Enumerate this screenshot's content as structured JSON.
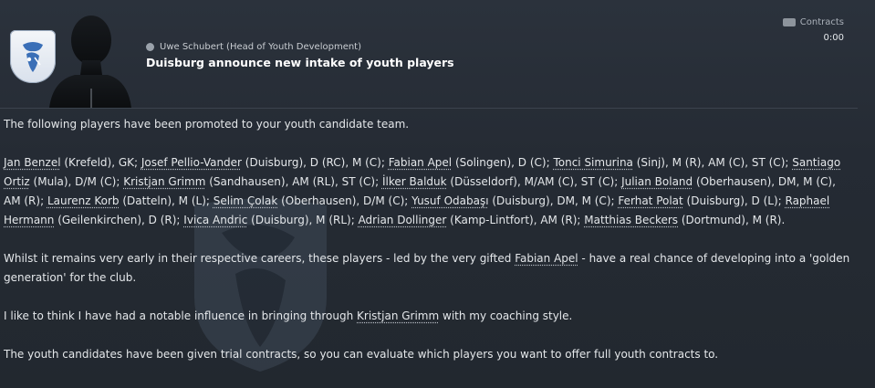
{
  "message": {
    "author": "Uwe Schubert  (Head of Youth Development)",
    "headline": "Duisburg announce new intake of youth players",
    "category": "Contracts",
    "time": "0:00"
  },
  "body": {
    "intro": "The following players have been promoted to your youth candidate team.",
    "players": [
      {
        "name": "Jan Benzel",
        "detail": " (Krefeld), GK; "
      },
      {
        "name": "Josef Pellio-Vander",
        "detail": " (Duisburg), D (RC), M (C); "
      },
      {
        "name": "Fabian Apel",
        "detail": " (Solingen), D (C); "
      },
      {
        "name": "Tonci Simurina",
        "detail": " (Sinj), M (R), AM (C), ST (C); "
      },
      {
        "name": "Santiago Ortiz",
        "detail": " (Mula), D/M (C); "
      },
      {
        "name": "Kristjan Grimm",
        "detail": " (Sandhausen), AM (RL), ST (C); "
      },
      {
        "name": "İlker Balduk",
        "detail": " (Düsseldorf), M/AM (C), ST (C); "
      },
      {
        "name": "Julian Boland",
        "detail": " (Oberhausen), DM, M (C), AM (R); "
      },
      {
        "name": "Laurenz Korb",
        "detail": " (Datteln), M (L); "
      },
      {
        "name": "Selim Çolak",
        "detail": " (Oberhausen), D/M (C); "
      },
      {
        "name": "Yusuf Odabaşı",
        "detail": " (Duisburg), DM, M (C); "
      },
      {
        "name": "Ferhat Polat",
        "detail": " (Duisburg), D (L); "
      },
      {
        "name": "Raphael Hermann",
        "detail": " (Geilenkirchen), D (R); "
      },
      {
        "name": "Ivica Andric",
        "detail": " (Duisburg), M (RL); "
      },
      {
        "name": "Adrian Dollinger",
        "detail": " (Kamp-Lintfort), AM (R);  "
      },
      {
        "name": "Matthias Beckers",
        "detail": " (Dortmund), M (R)."
      }
    ],
    "para3_pre": "Whilst it remains very early in their respective careers, these players - led by the very gifted ",
    "para3_link": "Fabian Apel",
    "para3_post": " - have a real chance of developing into a 'golden generation' for the club.",
    "para4_pre": "I like to think I have had a notable influence in bringing through ",
    "para4_link": "Kristjan Grimm",
    "para4_post": " with my coaching style.",
    "para5": "The youth candidates have been given trial contracts, so you can evaluate which players you want to offer full youth contracts to."
  }
}
